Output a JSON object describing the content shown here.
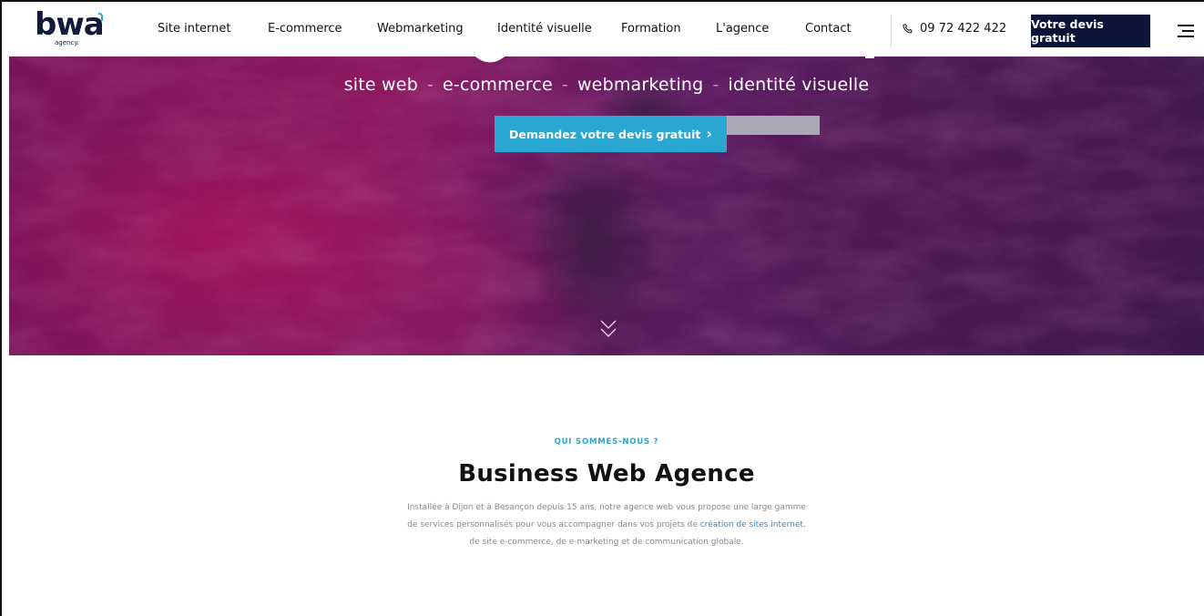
{
  "logo": {
    "word": "bwa",
    "sub": "agency."
  },
  "nav": {
    "items": [
      {
        "label": "Site internet"
      },
      {
        "label": "E-commerce"
      },
      {
        "label": "Webmarketing"
      },
      {
        "label": "Identité visuelle"
      },
      {
        "label": "Formation"
      },
      {
        "label": "L'agence"
      },
      {
        "label": "Contact"
      }
    ],
    "phone": "09 72 422 422",
    "cta": "Votre devis gratuit"
  },
  "hero": {
    "services": [
      "site web",
      "e-commerce",
      "webmarketing",
      "identité visuelle"
    ],
    "separator": "-",
    "cta": "Demandez votre devis gratuit",
    "cta_chevron": "›"
  },
  "about": {
    "kicker": "QUI SOMMES-NOUS ?",
    "title": "Business Web Agence",
    "text_line1": "Installée à Dijon et à Besançon depuis 15 ans, notre agence web vous propose une large gamme",
    "text_line2_before": "de services personnalisés pour vous accompagner dans vos projets de ",
    "text_link": "création de sites internet",
    "text_line2_after": ",",
    "text_line3": "de site e-commerce, de e-marketing et de communication globale."
  },
  "colors": {
    "navy": "#0c1538",
    "accent": "#2aa7d0",
    "hero_magenta": "#a31a6a"
  }
}
